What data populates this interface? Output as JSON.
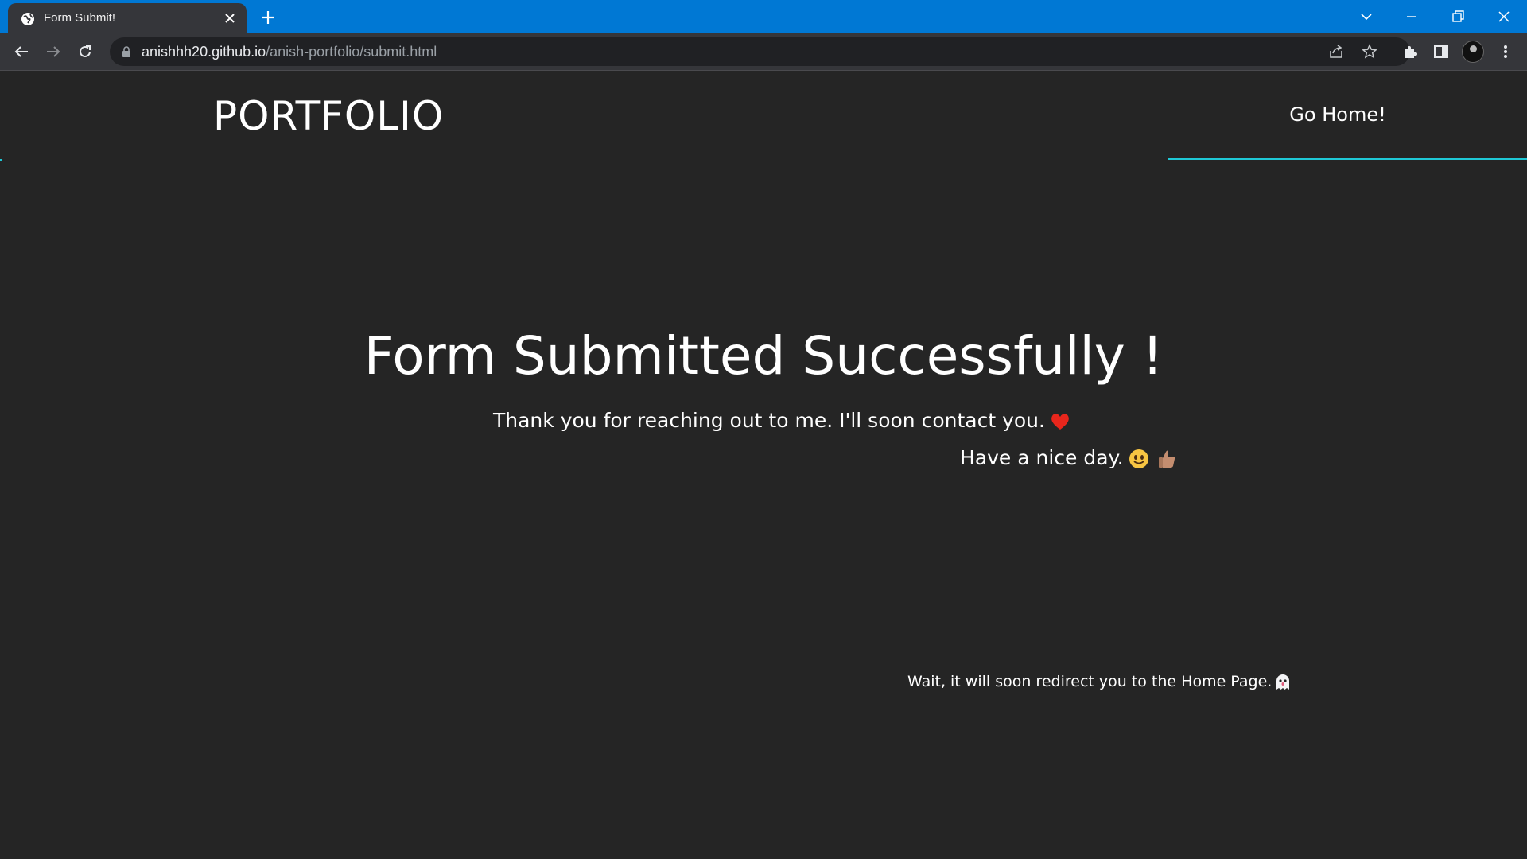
{
  "browser": {
    "tab": {
      "title": "Form Submit!"
    },
    "url_host": "anishhh20.github.io",
    "url_path": "/anish-portfolio/submit.html"
  },
  "site": {
    "logo": "PORTFOLIO",
    "nav": {
      "go_home": "Go Home!"
    }
  },
  "main": {
    "heading": "Form Submitted Successfully !",
    "message_1": "Thank you for reaching out to me. I'll soon contact you.",
    "message_2": "Have a nice day.",
    "redirect_note": "Wait, it will soon redirect you to the Home Page."
  },
  "icons": {
    "heart": "red-heart-icon",
    "smile": "smiling-face-icon",
    "thumbs_up": "thumbs-up-icon",
    "ghost": "ghost-icon"
  },
  "colors": {
    "page_bg": "#252525",
    "accent": "#1fc8d6",
    "tabstrip": "#0078d4",
    "toolbar": "#35363a"
  }
}
